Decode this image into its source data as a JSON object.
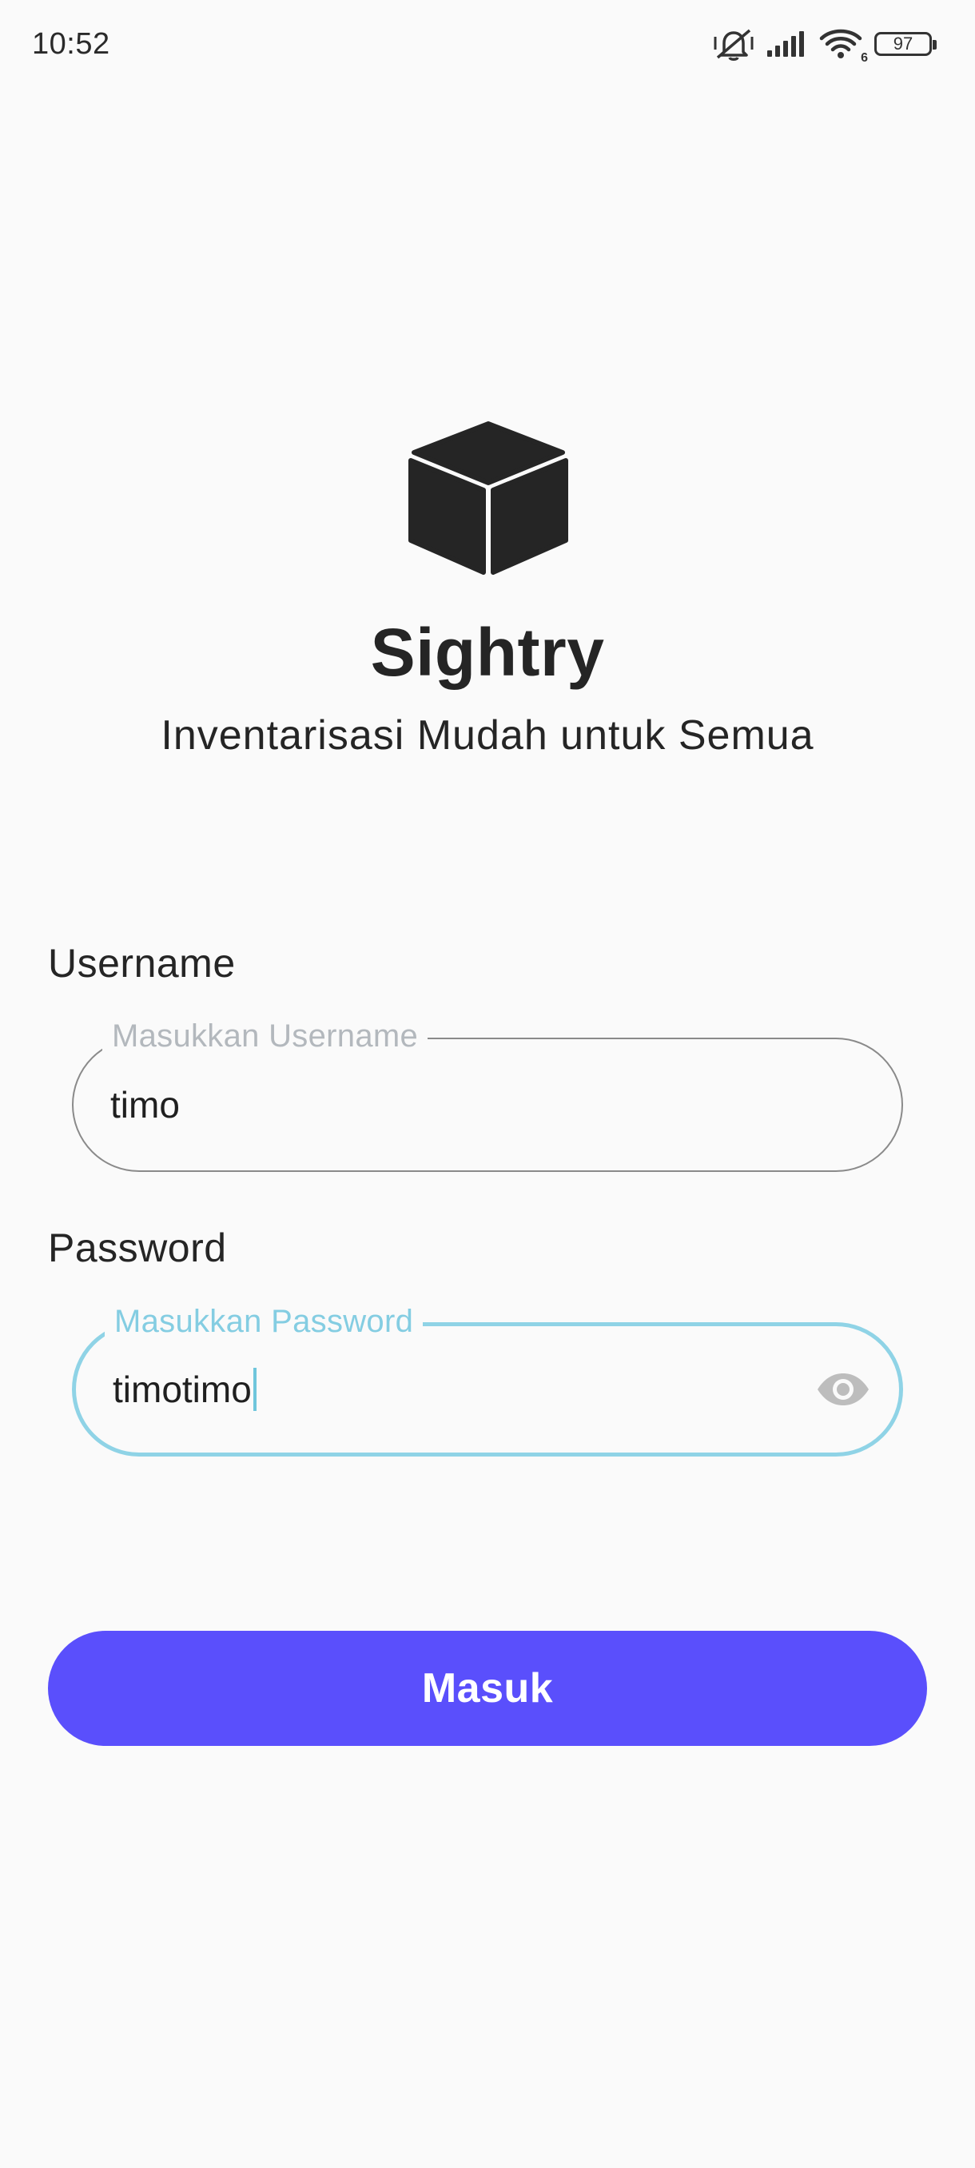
{
  "status_bar": {
    "time": "10:52",
    "battery_level": "97",
    "network_label": "6",
    "icons": [
      "silent-mode-icon",
      "signal-icon",
      "wifi-icon",
      "battery-icon"
    ]
  },
  "app": {
    "logo_icon": "cube-icon",
    "title": "Sightry",
    "subtitle": "Inventarisasi Mudah untuk Semua"
  },
  "form": {
    "username": {
      "label": "Username",
      "placeholder": "Masukkan Username",
      "value": "timo"
    },
    "password": {
      "label": "Password",
      "placeholder": "Masukkan Password",
      "value": "timotimo",
      "visibility_icon": "eye-icon"
    },
    "submit_label": "Masuk"
  },
  "colors": {
    "background": "#fafafa",
    "primary": "#5a4ffc",
    "focus_border": "#8fd3e6",
    "idle_border": "#8a8a8a",
    "text": "#252525"
  }
}
